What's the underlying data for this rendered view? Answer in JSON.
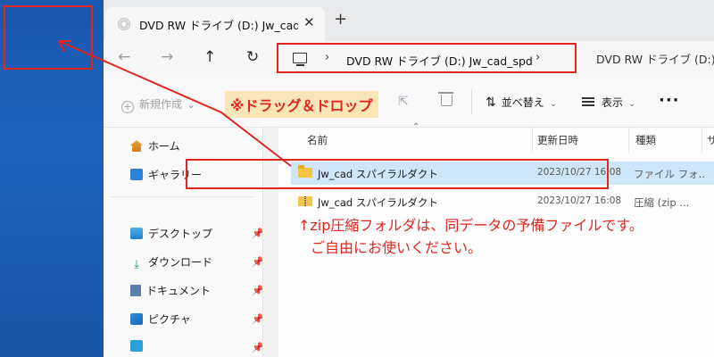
{
  "tab": {
    "title": "DVD RW ドライブ (D:) Jw_cad_spd",
    "close_glyph": "✕",
    "new_tab_glyph": "+"
  },
  "nav": {
    "back": "←",
    "forward": "→",
    "up": "↑",
    "refresh": "↻"
  },
  "address": {
    "chevron": "›",
    "path": "DVD RW ドライブ (D:) Jw_cad_spd"
  },
  "search": {
    "placeholder": "DVD RW ドライブ (D:) Jw_cad_spd"
  },
  "toolbar": {
    "new_label": "新規作成",
    "sort_label": "並べ替え",
    "view_label": "表示",
    "more_glyph": "···",
    "dropdown_glyph": "⌄",
    "sort_glyph": "⇅"
  },
  "annotation_dnd": "※ドラッグ＆ドロップ",
  "annotation_note": {
    "line1": "↑zip圧縮フォルダは、同データの予備ファイルです。",
    "line2": "ご自由にお使いください。"
  },
  "sidebar": {
    "pin_glyph": "📌",
    "items": [
      {
        "label": "ホーム"
      },
      {
        "label": "ギャラリー"
      },
      {
        "label": "デスクトップ"
      },
      {
        "label": "ダウンロード"
      },
      {
        "label": "ドキュメント"
      },
      {
        "label": "ピクチャ"
      }
    ]
  },
  "columns": {
    "name": "名前",
    "date": "更新日時",
    "type": "種類",
    "size": "サ"
  },
  "files": [
    {
      "name": "Jw_cad スパイラルダクト",
      "date": "2023/10/27 16:08",
      "type": "ファイル フォ..."
    },
    {
      "name": "Jw_cad スパイラルダクト",
      "date": "2023/10/27 16:08",
      "type": "圧縮 (zip ..."
    }
  ],
  "colors": {
    "annotation_red": "#e0261f",
    "selection": "#cfe6fa",
    "desktop_blue": "#1e5fb8"
  }
}
